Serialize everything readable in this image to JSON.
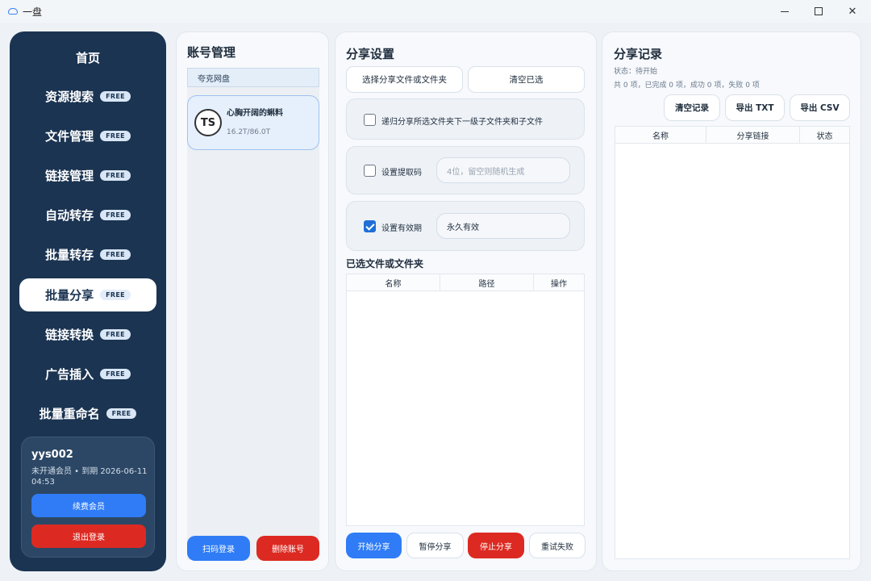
{
  "window": {
    "title": "一盘",
    "minimize_icon": "minimize-icon",
    "maximize_icon": "maximize-icon",
    "close_icon": "close-icon",
    "close_glyph": "✕"
  },
  "sidebar": {
    "items": [
      {
        "label": "首页",
        "badge": ""
      },
      {
        "label": "资源搜索",
        "badge": "FREE"
      },
      {
        "label": "文件管理",
        "badge": "FREE"
      },
      {
        "label": "链接管理",
        "badge": "FREE"
      },
      {
        "label": "自动转存",
        "badge": "FREE"
      },
      {
        "label": "批量转存",
        "badge": "FREE"
      },
      {
        "label": "批量分享",
        "badge": "FREE",
        "active": true
      },
      {
        "label": "链接转换",
        "badge": "FREE"
      },
      {
        "label": "广告插入",
        "badge": "FREE"
      },
      {
        "label": "批量重命名",
        "badge": "FREE"
      }
    ],
    "user": {
      "name": "yys002",
      "status": "未开通会员 • 到期 2026-06-11 04:53",
      "renew_label": "续费会员",
      "logout_label": "退出登录"
    }
  },
  "account_panel": {
    "title": "账号管理",
    "tab": "夸克网盘",
    "account": {
      "avatar_text": "TS",
      "name": "心胸开阔的蝌料",
      "capacity": "16.2T/86.0T"
    },
    "scan_label": "扫码登录",
    "delete_label": "删除账号"
  },
  "share_panel": {
    "title": "分享设置",
    "select_label": "选择分享文件或文件夹",
    "clear_label": "清空已选",
    "recursive": {
      "label": "递归分享所选文件夹下一级子文件夹和子文件",
      "checked": false
    },
    "code": {
      "label": "设置提取码",
      "checked": false,
      "placeholder": "4位，留空则随机生成"
    },
    "expiry": {
      "label": "设置有效期",
      "checked": true,
      "value": "永久有效"
    },
    "selected_title": "已选文件或文件夹",
    "columns": [
      "名称",
      "路径",
      "操作"
    ],
    "start_label": "开始分享",
    "pause_label": "暂停分享",
    "stop_label": "停止分享",
    "retry_label": "重试失败"
  },
  "records_panel": {
    "title": "分享记录",
    "status": "状态：待开始",
    "counts": "共 0 项，已完成 0 项，成功 0 项，失败 0 项",
    "clear_label": "清空记录",
    "export_txt_label": "导出 TXT",
    "export_csv_label": "导出 CSV",
    "columns": [
      "名称",
      "分享链接",
      "状态"
    ]
  },
  "colors": {
    "sidebar_bg": "#1b3452",
    "primary": "#2f7cf6",
    "danger": "#dc2a22"
  }
}
